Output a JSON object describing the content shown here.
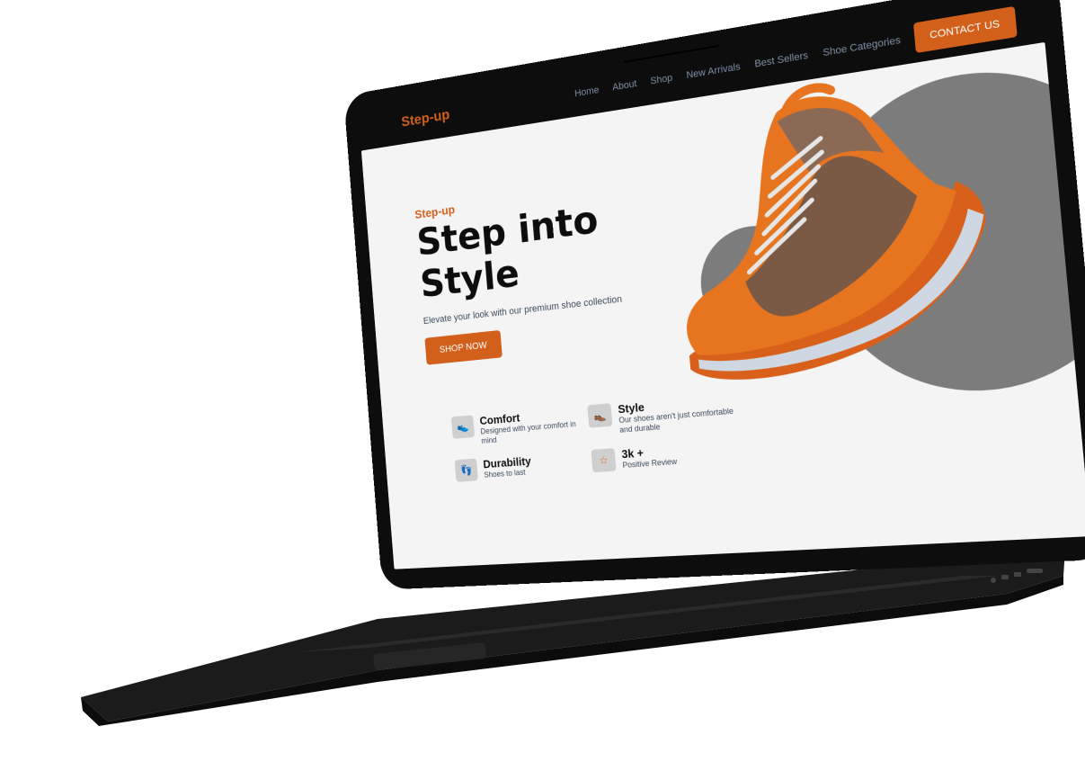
{
  "brand": {
    "logo": "Step-up",
    "accent": "#d2601a"
  },
  "nav": {
    "links": [
      "Home",
      "About",
      "Shop",
      "New Arrivals",
      "Best Sellers",
      "Shoe Categories"
    ],
    "cta": "CONTACT US"
  },
  "hero": {
    "eyebrow": "Step-up",
    "headline_line1": "Step into",
    "headline_line2": "Style",
    "subtitle": "Elevate your look with our premium shoe collection",
    "button": "SHOP NOW"
  },
  "features": [
    {
      "icon": "shoe-icon",
      "title": "Comfort",
      "desc": "Designed with your comfort in mind"
    },
    {
      "icon": "sneaker-icon",
      "title": "Style",
      "desc": "Our shoes aren't just comfortable and durable"
    },
    {
      "icon": "footprint-icon",
      "title": "Durability",
      "desc": "Shoes to last"
    },
    {
      "icon": "star-icon",
      "title": "3k +",
      "desc": "Positive Review"
    }
  ],
  "colors": {
    "background": "#f4f4f4",
    "dark": "#0d0d0d",
    "circle": "#7c7c7c"
  }
}
